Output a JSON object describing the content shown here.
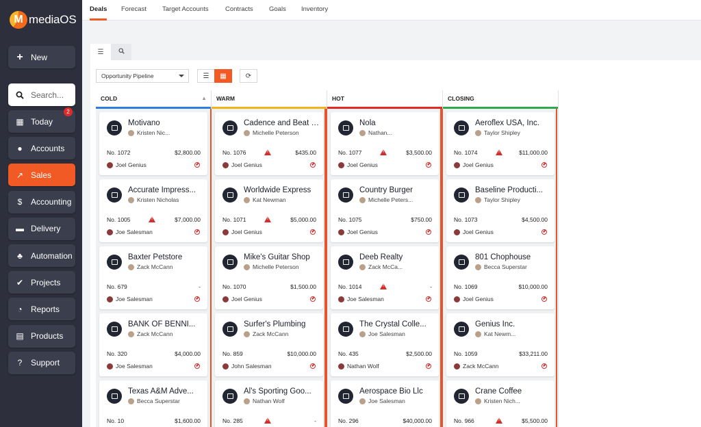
{
  "app": {
    "name": "mediaOS"
  },
  "sidebar": {
    "new": "New",
    "search_placeholder": "Search...",
    "items": [
      {
        "label": "Today",
        "icon": "calendar-icon",
        "badge": "2"
      },
      {
        "label": "Accounts",
        "icon": "users-icon"
      },
      {
        "label": "Sales",
        "icon": "chart-line-icon",
        "active": true
      },
      {
        "label": "Accounting",
        "icon": "dollar-icon"
      },
      {
        "label": "Delivery",
        "icon": "truck-icon"
      },
      {
        "label": "Automation",
        "icon": "sitemap-icon"
      },
      {
        "label": "Projects",
        "icon": "check-icon"
      },
      {
        "label": "Reports",
        "icon": "pie-chart-icon"
      },
      {
        "label": "Products",
        "icon": "book-icon"
      },
      {
        "label": "Support",
        "icon": "question-icon"
      }
    ]
  },
  "top_tabs": [
    "Deals",
    "Forecast",
    "Target Accounts",
    "Contracts",
    "Goals",
    "Inventory"
  ],
  "toolbar": {
    "pipeline": "Opportunity Pipeline"
  },
  "columns": [
    {
      "name": "COLD",
      "color": "#2f7de1"
    },
    {
      "name": "WARM",
      "color": "#f2b21b"
    },
    {
      "name": "HOT",
      "color": "#e02b2b"
    },
    {
      "name": "CLOSING",
      "color": "#2fa84f"
    }
  ],
  "cards": [
    [
      {
        "title": "Motivano",
        "owner": "Kristen Nic...",
        "num": "No. 1072",
        "warn": false,
        "amount": "$2,800.00",
        "rep": "Joel Genius"
      },
      {
        "title": "Accurate Impress...",
        "owner": "Kristen Nicholas",
        "num": "No. 1005",
        "warn": true,
        "amount": "$7,000.00",
        "rep": "Joe Salesman"
      },
      {
        "title": "Baxter Petstore",
        "owner": "Zack McCann",
        "num": "No. 679",
        "warn": false,
        "amount": "-",
        "rep": "Joe Salesman"
      },
      {
        "title": "BANK OF BENNI...",
        "owner": "Zack McCann",
        "num": "No. 320",
        "warn": false,
        "amount": "$4,000.00",
        "rep": "Joe Salesman"
      },
      {
        "title": "Texas A&M Adve...",
        "owner": "Becca Superstar",
        "num": "No. 10",
        "warn": false,
        "amount": "$1,600.00",
        "rep": ""
      }
    ],
    [
      {
        "title": "Cadence and Beat Mu",
        "owner": "Michelle Peterson",
        "num": "No. 1076",
        "warn": true,
        "amount": "$435.00",
        "rep": "Joel Genius"
      },
      {
        "title": "Worldwide Express",
        "owner": "Kat Newman",
        "num": "No. 1071",
        "warn": true,
        "amount": "$5,000.00",
        "rep": "Joel Genius"
      },
      {
        "title": "Mike's Guitar Shop",
        "owner": "Michelle Peterson",
        "num": "No. 1070",
        "warn": false,
        "amount": "$1,500.00",
        "rep": "Joel Genius"
      },
      {
        "title": "Surfer's Plumbing",
        "owner": "Zack McCann",
        "num": "No. 859",
        "warn": false,
        "amount": "$10,000.00",
        "rep": "John Salesman"
      },
      {
        "title": "Al's Sporting Goo...",
        "owner": "Nathan Wolf",
        "num": "No. 285",
        "warn": true,
        "amount": "-",
        "rep": ""
      }
    ],
    [
      {
        "title": "Nola",
        "owner": "Nathan...",
        "num": "No. 1077",
        "warn": true,
        "amount": "$3,500.00",
        "rep": "Joel Genius"
      },
      {
        "title": "Country Burger",
        "owner": "Michelle Peters...",
        "num": "No. 1075",
        "warn": false,
        "amount": "$750.00",
        "rep": "Joel Genius"
      },
      {
        "title": "Deeb Realty",
        "owner": "Zack McCa...",
        "num": "No. 1014",
        "warn": true,
        "amount": "-",
        "rep": "Joe Salesman"
      },
      {
        "title": "The Crystal Colle...",
        "owner": "Joe Salesman",
        "num": "No. 435",
        "warn": false,
        "amount": "$2,500.00",
        "rep": "Nathan Wolf"
      },
      {
        "title": "Aerospace Bio Llc",
        "owner": "Joe Salesman",
        "num": "No. 296",
        "warn": false,
        "amount": "$40,000.00",
        "rep": ""
      }
    ],
    [
      {
        "title": "Aeroflex USA, Inc.",
        "owner": "Taylor Shipley",
        "num": "No. 1074",
        "warn": true,
        "amount": "$11,000.00",
        "rep": "Joel Genius"
      },
      {
        "title": "Baseline Producti...",
        "owner": "Taylor Shipley",
        "num": "No. 1073",
        "warn": false,
        "amount": "$4,500.00",
        "rep": "Joel Genius"
      },
      {
        "title": "801 Chophouse",
        "owner": "Becca Superstar",
        "num": "No. 1069",
        "warn": false,
        "amount": "$10,000.00",
        "rep": "Joel Genius"
      },
      {
        "title": "Genius Inc.",
        "owner": "Kat Newm...",
        "num": "No. 1059",
        "warn": false,
        "amount": "$33,211.00",
        "rep": "Zack McCann"
      },
      {
        "title": "Crane Coffee",
        "owner": "Kristen Nich...",
        "num": "No. 966",
        "warn": true,
        "amount": "$5,500.00",
        "rep": ""
      }
    ]
  ]
}
